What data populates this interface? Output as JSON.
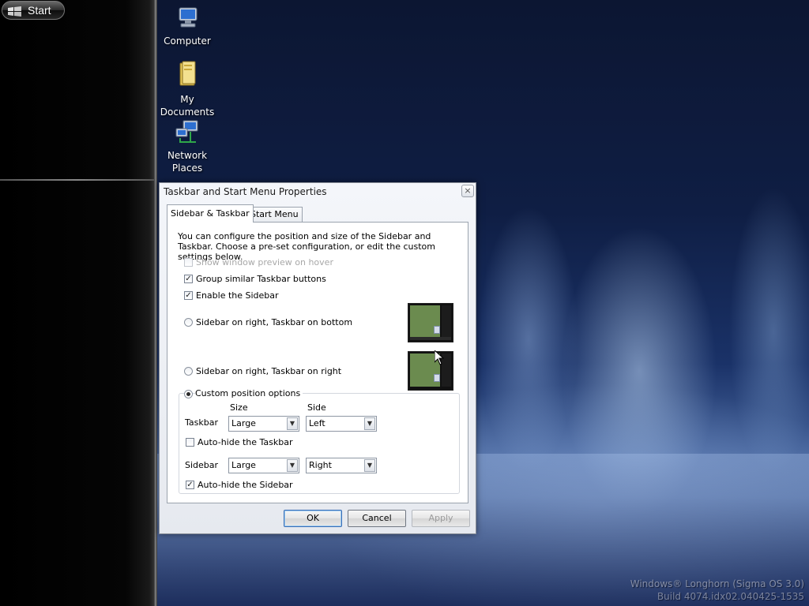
{
  "start": {
    "label": "Start"
  },
  "desktop": {
    "icons": [
      {
        "label": "Computer"
      },
      {
        "label": "My\nDocuments"
      },
      {
        "label": "Network\nPlaces"
      }
    ],
    "watermark": {
      "line1": "Windows® Longhorn (Sigma OS 3.0)",
      "line2": "Build 4074.idx02.040425-1535"
    }
  },
  "dialog": {
    "title": "Taskbar and Start Menu Properties",
    "close": "×",
    "tabs": [
      {
        "label": "Sidebar & Taskbar",
        "active": true
      },
      {
        "label": "Start Menu",
        "active": false
      }
    ],
    "intro": "You can configure the position and size of the Sidebar and Taskbar. Choose a pre-set configuration, or edit the custom settings below.",
    "checks": {
      "preview": {
        "label": "Show window preview on hover",
        "checked": false,
        "enabled": false
      },
      "group": {
        "label": "Group similar Taskbar buttons",
        "checked": true
      },
      "sidebar": {
        "label": "Enable the Sidebar",
        "checked": true
      }
    },
    "radios": {
      "bottom": {
        "label": "Sidebar on right, Taskbar on bottom",
        "selected": false
      },
      "right": {
        "label": "Sidebar on right, Taskbar on right",
        "selected": false
      },
      "custom": {
        "label": "Custom position options",
        "selected": true
      }
    },
    "custom": {
      "size_header": "Size",
      "side_header": "Side",
      "taskbar_label": "Taskbar",
      "taskbar_size": "Large",
      "taskbar_side": "Left",
      "autohide_taskbar": {
        "label": "Auto-hide the Taskbar",
        "checked": false
      },
      "sidebar_label": "Sidebar",
      "sidebar_size": "Large",
      "sidebar_side": "Right",
      "autohide_sidebar": {
        "label": "Auto-hide the Sidebar",
        "checked": true
      }
    },
    "buttons": {
      "ok": "OK",
      "cancel": "Cancel",
      "apply": "Apply"
    },
    "check_glyph": "✓",
    "arrow_glyph": "▼"
  },
  "colors": {
    "desktop_top": "#0c1632",
    "desktop_glow": "#5d7eb6",
    "thumb_screen": "#6b8b4f"
  }
}
